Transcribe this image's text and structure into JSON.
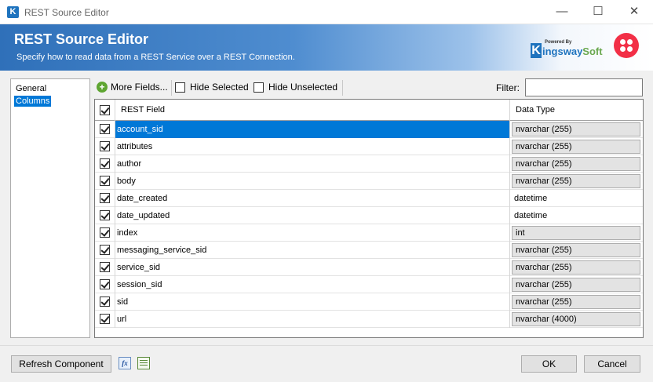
{
  "window": {
    "title": "REST Source Editor",
    "minimize": "—",
    "maximize": "☐",
    "close": "✕"
  },
  "banner": {
    "title": "REST Source Editor",
    "subtitle": "Specify how to read data from a REST Service over a REST Connection.",
    "logo_powered": "Powered By",
    "logo_k": "K",
    "logo_name_a": "ingsway",
    "logo_name_b": "Soft"
  },
  "nav": {
    "items": [
      {
        "label": "General",
        "selected": false
      },
      {
        "label": "Columns",
        "selected": true
      }
    ]
  },
  "toolbar": {
    "more_fields": "More Fields...",
    "hide_selected": "Hide Selected",
    "hide_unselected": "Hide Unselected",
    "filter_label": "Filter:",
    "filter_value": ""
  },
  "grid": {
    "header_field": "REST Field",
    "header_type": "Data Type",
    "rows": [
      {
        "field": "account_sid",
        "type": "nvarchar (255)",
        "boxed": true,
        "checked": true,
        "selected": true
      },
      {
        "field": "attributes",
        "type": "nvarchar (255)",
        "boxed": true,
        "checked": true,
        "selected": false
      },
      {
        "field": "author",
        "type": "nvarchar (255)",
        "boxed": true,
        "checked": true,
        "selected": false
      },
      {
        "field": "body",
        "type": "nvarchar (255)",
        "boxed": true,
        "checked": true,
        "selected": false
      },
      {
        "field": "date_created",
        "type": "datetime",
        "boxed": false,
        "checked": true,
        "selected": false
      },
      {
        "field": "date_updated",
        "type": "datetime",
        "boxed": false,
        "checked": true,
        "selected": false
      },
      {
        "field": "index",
        "type": "int",
        "boxed": true,
        "checked": true,
        "selected": false
      },
      {
        "field": "messaging_service_sid",
        "type": "nvarchar (255)",
        "boxed": true,
        "checked": true,
        "selected": false
      },
      {
        "field": "service_sid",
        "type": "nvarchar (255)",
        "boxed": true,
        "checked": true,
        "selected": false
      },
      {
        "field": "session_sid",
        "type": "nvarchar (255)",
        "boxed": true,
        "checked": true,
        "selected": false
      },
      {
        "field": "sid",
        "type": "nvarchar (255)",
        "boxed": true,
        "checked": true,
        "selected": false
      },
      {
        "field": "url",
        "type": "nvarchar (4000)",
        "boxed": true,
        "checked": true,
        "selected": false
      }
    ]
  },
  "footer": {
    "refresh": "Refresh Component",
    "fx_icon": "fx",
    "ok": "OK",
    "cancel": "Cancel"
  }
}
